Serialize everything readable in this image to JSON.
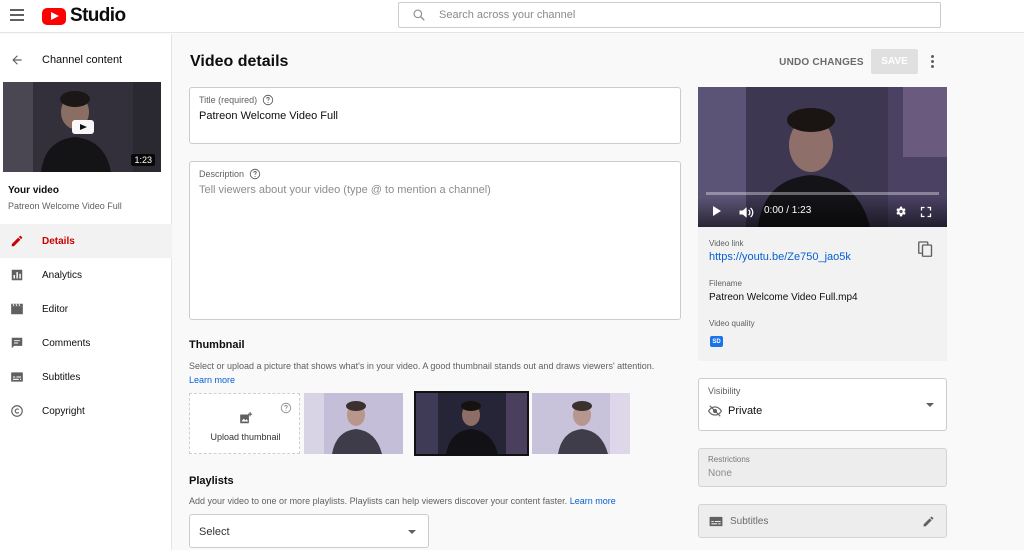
{
  "app": {
    "name": "Studio",
    "brand_color": "#ff0000",
    "link_color": "#065fd4",
    "active_color": "#cc0000"
  },
  "search": {
    "placeholder": "Search across your channel"
  },
  "sidebar": {
    "back_label": "Channel content",
    "video_duration": "1:23",
    "your_video_label": "Your video",
    "video_name": "Patreon Welcome Video Full",
    "items": [
      {
        "label": "Details",
        "icon": "pencil-icon",
        "active": true
      },
      {
        "label": "Analytics",
        "icon": "bar-chart-icon",
        "active": false
      },
      {
        "label": "Editor",
        "icon": "film-icon",
        "active": false
      },
      {
        "label": "Comments",
        "icon": "comment-icon",
        "active": false
      },
      {
        "label": "Subtitles",
        "icon": "subtitles-icon",
        "active": false
      },
      {
        "label": "Copyright",
        "icon": "copyright-icon",
        "active": false
      }
    ]
  },
  "header": {
    "title": "Video details",
    "undo_label": "UNDO CHANGES",
    "save_label": "SAVE"
  },
  "form": {
    "title_label": "Title (required)",
    "title_value": "Patreon Welcome Video Full",
    "description_label": "Description",
    "description_placeholder": "Tell viewers about your video (type @ to mention a channel)"
  },
  "thumbnail": {
    "heading": "Thumbnail",
    "description": "Select or upload a picture that shows what's in your video. A good thumbnail stands out and draws viewers' attention.",
    "learn_more": "Learn more",
    "upload_label": "Upload thumbnail",
    "selected_index": 1
  },
  "playlists": {
    "heading": "Playlists",
    "description": "Add your video to one or more playlists. Playlists can help viewers discover your content faster.",
    "learn_more": "Learn more",
    "select_value": "Select"
  },
  "player": {
    "time": "0:00 / 1:23",
    "progress": 0
  },
  "video_info": {
    "link_label": "Video link",
    "link_value": "https://youtu.be/Ze750_jao5k",
    "filename_label": "Filename",
    "filename_value": "Patreon Welcome Video Full.mp4",
    "quality_label": "Video quality",
    "quality_badge": "SD"
  },
  "visibility": {
    "label": "Visibility",
    "value": "Private"
  },
  "restrictions": {
    "label": "Restrictions",
    "value": "None"
  },
  "subtitles": {
    "label": "Subtitles"
  }
}
